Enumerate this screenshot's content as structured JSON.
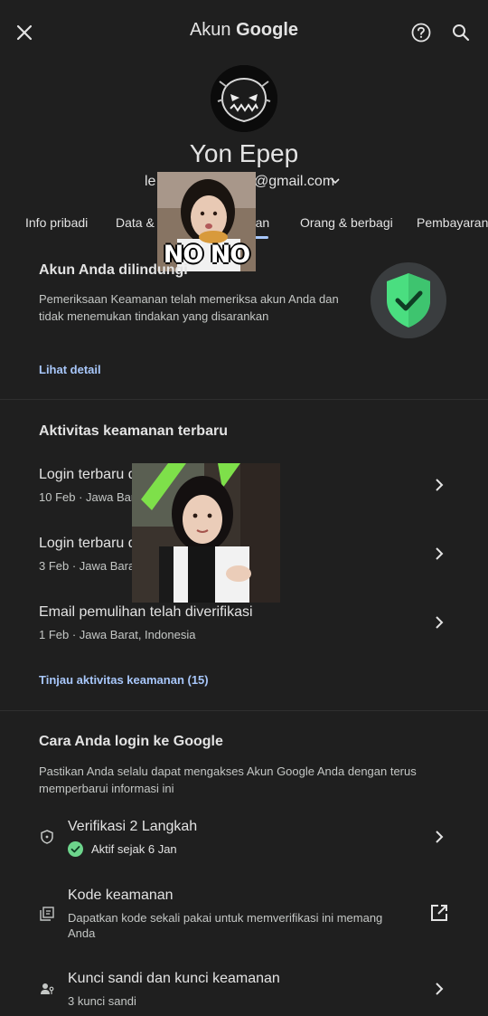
{
  "topbar": {
    "title_prefix": "Akun",
    "title_brand": "Google"
  },
  "profile": {
    "name": "Yon Epep",
    "email_start": "le",
    "email_end": "@gmail.com"
  },
  "tabs": [
    {
      "label": "Info pribadi"
    },
    {
      "label": "Data & p"
    },
    {
      "label": "anan"
    },
    {
      "label": "Orang & berbagi"
    },
    {
      "label": "Pembayaran &"
    }
  ],
  "sticker": {
    "caption": "NO NO"
  },
  "protected": {
    "title": "Akun Anda dilindungi",
    "body_line1": "Pemeriksaan Keamanan telah memeriksa akun Anda dan",
    "body_line2": "tidak menemukan tindakan yang disarankan",
    "link": "Lihat detail"
  },
  "activity": {
    "title": "Aktivitas keamanan terbaru",
    "items": [
      {
        "title": "Login terbaru d",
        "sub": "10 Feb · Jawa Bar"
      },
      {
        "title": "Login terbaru d",
        "sub": "3 Feb · Jawa Bara"
      },
      {
        "title": "Email pemulihan telah diverifikasi",
        "sub": "1 Feb · Jawa Barat, Indonesia"
      }
    ],
    "link": "Tinjau aktivitas keamanan (15)"
  },
  "signin": {
    "title": "Cara Anda login ke Google",
    "body_line1": "Pastikan Anda selalu dapat mengakses Akun Google Anda dengan terus",
    "body_line2": "memperbarui informasi ini",
    "items": [
      {
        "title": "Verifikasi 2 Langkah",
        "sub": "Aktif sejak 6 Jan"
      },
      {
        "title": "Kode keamanan",
        "sub_line1": "Dapatkan kode sekali pakai untuk memverifikasi ini memang",
        "sub_line2": "Anda"
      },
      {
        "title": "Kunci sandi dan kunci keamanan",
        "sub": "3 kunci sandi"
      }
    ]
  },
  "colors": {
    "background": "#1f1f1f",
    "link": "#a8c7fa",
    "shield_green": "#4ade80"
  }
}
